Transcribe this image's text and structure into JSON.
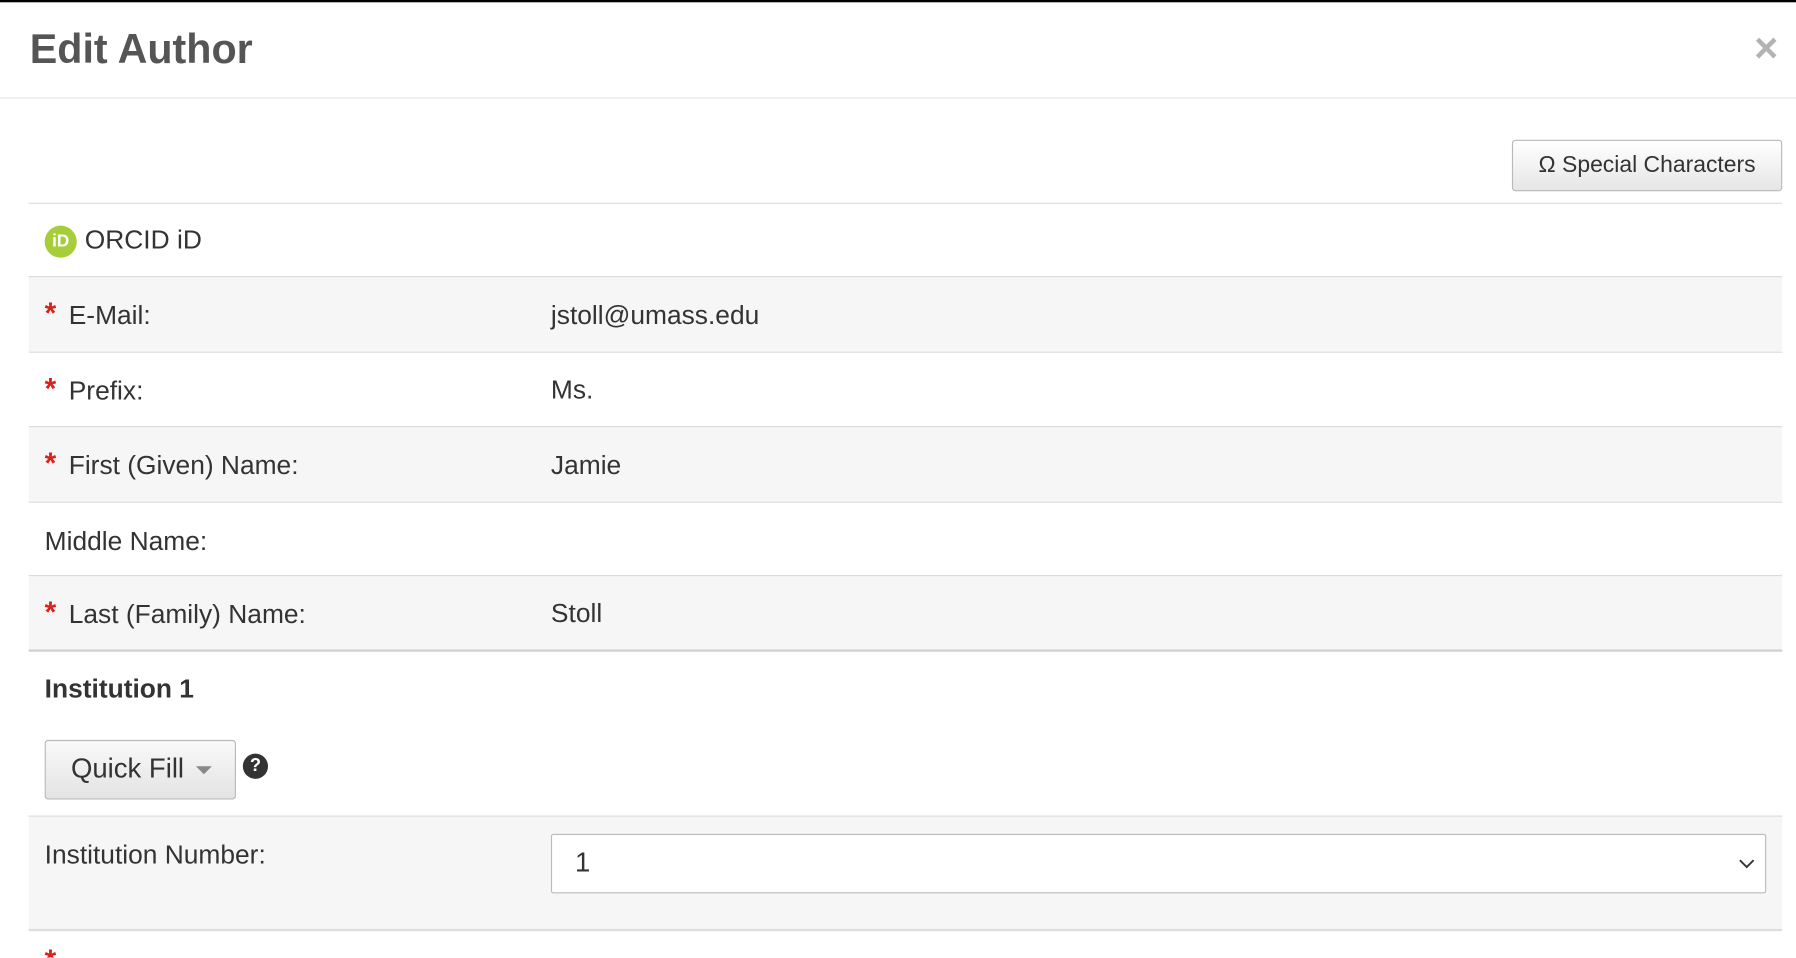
{
  "dialog": {
    "title": "Edit Author",
    "close_label": "×"
  },
  "toolbar": {
    "special_characters_label": "Ω Special Characters"
  },
  "orcid": {
    "icon_text": "iD",
    "label": "ORCID iD"
  },
  "fields": {
    "email": {
      "label": "E-Mail:",
      "value": "jstoll@umass.edu",
      "required": true
    },
    "prefix": {
      "label": "Prefix:",
      "value": "Ms.",
      "required": true
    },
    "first_name": {
      "label": "First (Given) Name:",
      "value": "Jamie",
      "required": true
    },
    "middle_name": {
      "label": "Middle Name:",
      "value": "",
      "required": false
    },
    "last_name": {
      "label": "Last (Family) Name:",
      "value": "Stoll",
      "required": true
    }
  },
  "institution": {
    "section_title": "Institution 1",
    "quick_fill_label": "Quick Fill",
    "help_icon": "?",
    "number_label": "Institution Number:",
    "number_value": "1"
  },
  "required_marker": "*",
  "colors": {
    "required": "#d9221c",
    "orcid_green": "#a6ce39",
    "row_alt_bg": "#f6f6f6"
  },
  "icons": [
    "close-icon",
    "omega-icon",
    "orcid-icon",
    "chevron-down-icon",
    "question-circle-icon",
    "caret-down-icon"
  ]
}
